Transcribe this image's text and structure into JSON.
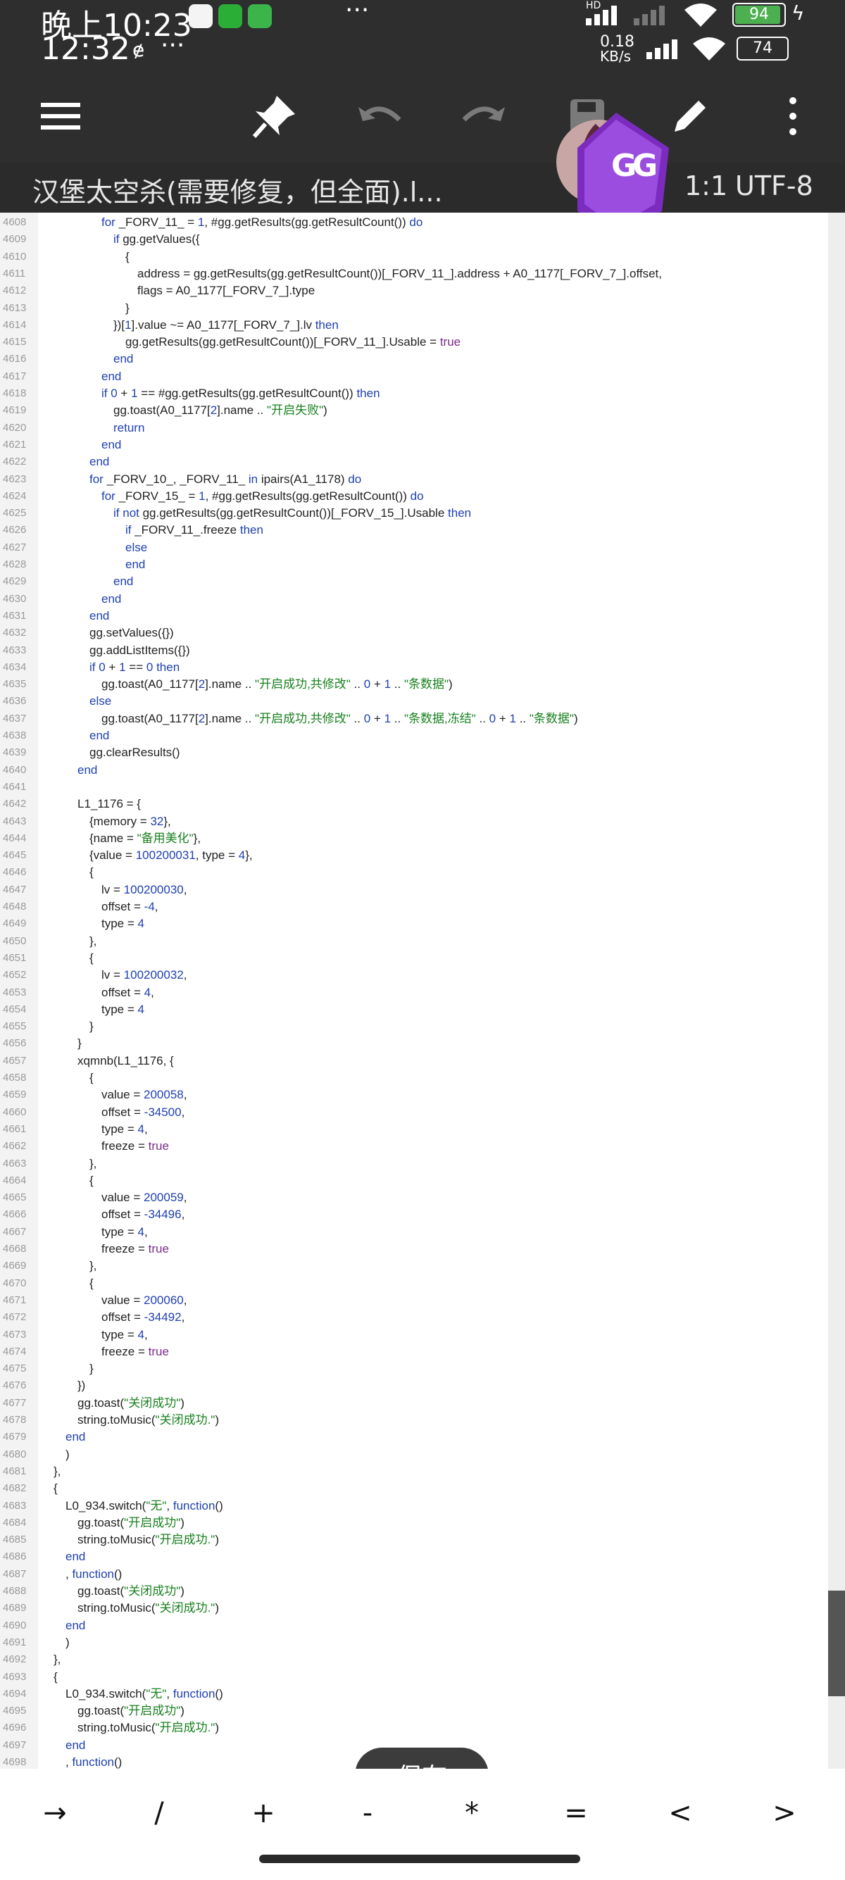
{
  "status_bar": {
    "time_top": "晚上10:23",
    "time_bottom": "12:32",
    "speed": "0.18",
    "speed_unit": "KB/s",
    "battery_top": "94",
    "battery_bottom": "74",
    "hd_label": "HD"
  },
  "toolbar": {
    "icons": [
      "menu-icon",
      "pin-icon",
      "undo-icon",
      "redo-icon",
      "save-disk-icon",
      "edit-pencil-icon",
      "more-vert-icon"
    ]
  },
  "file": {
    "title": "汉堡太空杀(需要修复，但全面).l...",
    "ratio": "1:1",
    "encoding": "UTF-8"
  },
  "code_lines": [
    {
      "n": "4608",
      "i": 4,
      "t": "for _FORV_11_ = 1, #gg.getResults(gg.getResultCount()) do"
    },
    {
      "n": "4609",
      "i": 5,
      "t": "if gg.getValues({"
    },
    {
      "n": "4610",
      "i": 6,
      "t": "{"
    },
    {
      "n": "4611",
      "i": 7,
      "t": "address = gg.getResults(gg.getResultCount())[_FORV_11_].address + A0_1177[_FORV_7_].offset,"
    },
    {
      "n": "4612",
      "i": 7,
      "t": "flags = A0_1177[_FORV_7_].type"
    },
    {
      "n": "4613",
      "i": 6,
      "t": "}"
    },
    {
      "n": "4614",
      "i": 5,
      "t": "})[1].value ~= A0_1177[_FORV_7_].lv then"
    },
    {
      "n": "4615",
      "i": 6,
      "t": "gg.getResults(gg.getResultCount())[_FORV_11_].Usable = true"
    },
    {
      "n": "4616",
      "i": 5,
      "t": "end"
    },
    {
      "n": "4617",
      "i": 4,
      "t": "end"
    },
    {
      "n": "4618",
      "i": 4,
      "t": "if 0 + 1 == #gg.getResults(gg.getResultCount()) then"
    },
    {
      "n": "4619",
      "i": 5,
      "t": "gg.toast(A0_1177[2].name .. \"开启失败\")"
    },
    {
      "n": "4620",
      "i": 5,
      "t": "return"
    },
    {
      "n": "4621",
      "i": 4,
      "t": "end"
    },
    {
      "n": "4622",
      "i": 3,
      "t": "end"
    },
    {
      "n": "4623",
      "i": 3,
      "t": "for _FORV_10_, _FORV_11_ in ipairs(A1_1178) do"
    },
    {
      "n": "4624",
      "i": 4,
      "t": "for _FORV_15_ = 1, #gg.getResults(gg.getResultCount()) do"
    },
    {
      "n": "4625",
      "i": 5,
      "t": "if not gg.getResults(gg.getResultCount())[_FORV_15_].Usable then"
    },
    {
      "n": "4626",
      "i": 6,
      "t": "if _FORV_11_.freeze then"
    },
    {
      "n": "4627",
      "i": 6,
      "t": "else"
    },
    {
      "n": "4628",
      "i": 6,
      "t": "end"
    },
    {
      "n": "4629",
      "i": 5,
      "t": "end"
    },
    {
      "n": "4630",
      "i": 4,
      "t": "end"
    },
    {
      "n": "4631",
      "i": 3,
      "t": "end"
    },
    {
      "n": "4632",
      "i": 3,
      "t": "gg.setValues({})"
    },
    {
      "n": "4633",
      "i": 3,
      "t": "gg.addListItems({})"
    },
    {
      "n": "4634",
      "i": 3,
      "t": "if 0 + 1 == 0 then"
    },
    {
      "n": "4635",
      "i": 4,
      "t": "gg.toast(A0_1177[2].name .. \"开启成功,共修改\" .. 0 + 1 .. \"条数据\")"
    },
    {
      "n": "4636",
      "i": 3,
      "t": "else"
    },
    {
      "n": "4637",
      "i": 4,
      "t": "gg.toast(A0_1177[2].name .. \"开启成功,共修改\" .. 0 + 1 .. \"条数据,冻结\" .. 0 + 1 .. \"条数据\")"
    },
    {
      "n": "4638",
      "i": 3,
      "t": "end"
    },
    {
      "n": "4639",
      "i": 3,
      "t": "gg.clearResults()"
    },
    {
      "n": "4640",
      "i": 2,
      "t": "end"
    },
    {
      "n": "4641",
      "i": 0,
      "t": ""
    },
    {
      "n": "4642",
      "i": 2,
      "t": "L1_1176 = {"
    },
    {
      "n": "4643",
      "i": 3,
      "t": "{memory = 32},"
    },
    {
      "n": "4644",
      "i": 3,
      "t": "{name = \"备用美化\"},"
    },
    {
      "n": "4645",
      "i": 3,
      "t": "{value = 100200031, type = 4},"
    },
    {
      "n": "4646",
      "i": 3,
      "t": "{"
    },
    {
      "n": "4647",
      "i": 4,
      "t": "lv = 100200030,"
    },
    {
      "n": "4648",
      "i": 4,
      "t": "offset = -4,"
    },
    {
      "n": "4649",
      "i": 4,
      "t": "type = 4"
    },
    {
      "n": "4650",
      "i": 3,
      "t": "},"
    },
    {
      "n": "4651",
      "i": 3,
      "t": "{"
    },
    {
      "n": "4652",
      "i": 4,
      "t": "lv = 100200032,"
    },
    {
      "n": "4653",
      "i": 4,
      "t": "offset = 4,"
    },
    {
      "n": "4654",
      "i": 4,
      "t": "type = 4"
    },
    {
      "n": "4655",
      "i": 3,
      "t": "}"
    },
    {
      "n": "4656",
      "i": 2,
      "t": "}"
    },
    {
      "n": "4657",
      "i": 2,
      "t": "xqmnb(L1_1176, {"
    },
    {
      "n": "4658",
      "i": 3,
      "t": "{"
    },
    {
      "n": "4659",
      "i": 4,
      "t": "value = 200058,"
    },
    {
      "n": "4660",
      "i": 4,
      "t": "offset = -34500,"
    },
    {
      "n": "4661",
      "i": 4,
      "t": "type = 4,"
    },
    {
      "n": "4662",
      "i": 4,
      "t": "freeze = true"
    },
    {
      "n": "4663",
      "i": 3,
      "t": "},"
    },
    {
      "n": "4664",
      "i": 3,
      "t": "{"
    },
    {
      "n": "4665",
      "i": 4,
      "t": "value = 200059,"
    },
    {
      "n": "4666",
      "i": 4,
      "t": "offset = -34496,"
    },
    {
      "n": "4667",
      "i": 4,
      "t": "type = 4,"
    },
    {
      "n": "4668",
      "i": 4,
      "t": "freeze = true"
    },
    {
      "n": "4669",
      "i": 3,
      "t": "},"
    },
    {
      "n": "4670",
      "i": 3,
      "t": "{"
    },
    {
      "n": "4671",
      "i": 4,
      "t": "value = 200060,"
    },
    {
      "n": "4672",
      "i": 4,
      "t": "offset = -34492,"
    },
    {
      "n": "4673",
      "i": 4,
      "t": "type = 4,"
    },
    {
      "n": "4674",
      "i": 4,
      "t": "freeze = true"
    },
    {
      "n": "4675",
      "i": 3,
      "t": "}"
    },
    {
      "n": "4676",
      "i": 2,
      "t": "})"
    },
    {
      "n": "4677",
      "i": 2,
      "t": "gg.toast(\"关闭成功\")"
    },
    {
      "n": "4678",
      "i": 2,
      "t": "string.toMusic(\"关闭成功.\")"
    },
    {
      "n": "4679",
      "i": 1,
      "t": "end"
    },
    {
      "n": "4680",
      "i": 1,
      "t": ")"
    },
    {
      "n": "4681",
      "i": 0,
      "t": "},"
    },
    {
      "n": "4682",
      "i": 0,
      "t": "{"
    },
    {
      "n": "4683",
      "i": 1,
      "t": "L0_934.switch(\"无\", function()"
    },
    {
      "n": "4684",
      "i": 2,
      "t": "gg.toast(\"开启成功\")"
    },
    {
      "n": "4685",
      "i": 2,
      "t": "string.toMusic(\"开启成功.\")"
    },
    {
      "n": "4686",
      "i": 1,
      "t": "end"
    },
    {
      "n": "4687",
      "i": 1,
      "t": ", function()"
    },
    {
      "n": "4688",
      "i": 2,
      "t": "gg.toast(\"关闭成功\")"
    },
    {
      "n": "4689",
      "i": 2,
      "t": "string.toMusic(\"关闭成功.\")"
    },
    {
      "n": "4690",
      "i": 1,
      "t": "end"
    },
    {
      "n": "4691",
      "i": 1,
      "t": ")"
    },
    {
      "n": "4692",
      "i": 0,
      "t": "},"
    },
    {
      "n": "4693",
      "i": 0,
      "t": "{"
    },
    {
      "n": "4694",
      "i": 1,
      "t": "L0_934.switch(\"无\", function()"
    },
    {
      "n": "4695",
      "i": 2,
      "t": "gg.toast(\"开启成功\")"
    },
    {
      "n": "4696",
      "i": 2,
      "t": "string.toMusic(\"开启成功.\")"
    },
    {
      "n": "4697",
      "i": 1,
      "t": "end"
    },
    {
      "n": "4698",
      "i": 1,
      "t": ", function()"
    }
  ],
  "save_button": "保存",
  "keyboard_keys": [
    "→",
    "/",
    "+",
    "-",
    "*",
    "=",
    "<",
    ">"
  ],
  "scroll_position": 0.95,
  "colors": {
    "bar_bg": "#2e2e2e",
    "keyword": "#1f3fb0",
    "string": "#19801f",
    "boolean": "#7a2a8a",
    "logo_purple": "#7b2cbf"
  }
}
